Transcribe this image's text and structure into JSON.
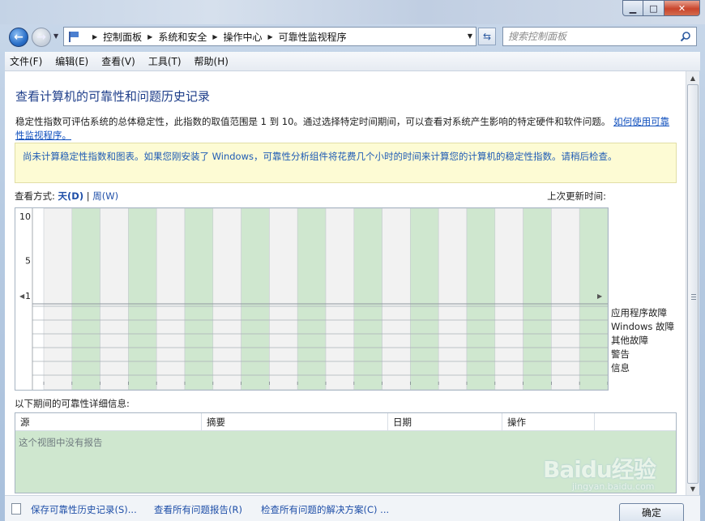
{
  "window": {
    "min_glyph": "▁",
    "max_glyph": "□",
    "close_glyph": "✕"
  },
  "nav": {
    "breadcrumbs": [
      "控制面板",
      "系统和安全",
      "操作中心",
      "可靠性监视程序"
    ]
  },
  "search": {
    "placeholder": "搜索控制面板"
  },
  "menu": [
    "文件(F)",
    "编辑(E)",
    "查看(V)",
    "工具(T)",
    "帮助(H)"
  ],
  "main": {
    "title": "查看计算机的可靠性和问题历史记录",
    "description": "稳定性指数可评估系统的总体稳定性，此指数的取值范围是 1 到 10。通过选择特定时间期间，可以查看对系统产生影响的特定硬件和软件问题。",
    "description_link": "如何使用可靠性监视程序。",
    "notice": "尚未计算稳定性指数和图表。如果您刚安装了 Windows，可靠性分析组件将花费几个小时的时间来计算您的计算机的稳定性指数。请稍后检查。",
    "view_by_label": "查看方式:",
    "view_day": "天(D)",
    "view_separator": "|",
    "view_week": "周(W)",
    "last_updated_label": "上次更新时间:"
  },
  "chart_data": {
    "type": "bar",
    "y_ticks": [
      "10",
      "5",
      "1"
    ],
    "ylim": [
      1,
      10
    ],
    "column_count": 20,
    "shading": [
      "gray",
      "green"
    ],
    "rows": [
      "应用程序故障",
      "Windows 故障",
      "其他故障",
      "警告",
      "信息"
    ],
    "values": []
  },
  "details": {
    "label": "以下期间的可靠性详细信息:",
    "columns": [
      "源",
      "摘要",
      "日期",
      "操作"
    ],
    "empty_text": "这个视图中没有报告"
  },
  "bottom": {
    "save_link": "保存可靠性历史记录(S)...",
    "view_all_link": "查看所有问题报告(R)",
    "check_link": "检查所有问题的解决方案(C) ...",
    "ok_label": "确定"
  },
  "watermark": {
    "main": "Baidu经验",
    "sub": "jingyan.baidu.com"
  },
  "colors": {
    "green_column": "#cfe7cf",
    "gray_column": "#f2f2f2",
    "title_blue": "#1e3e8a",
    "link_blue": "#1f4fa8",
    "notice_bg": "#fdfbd4"
  }
}
